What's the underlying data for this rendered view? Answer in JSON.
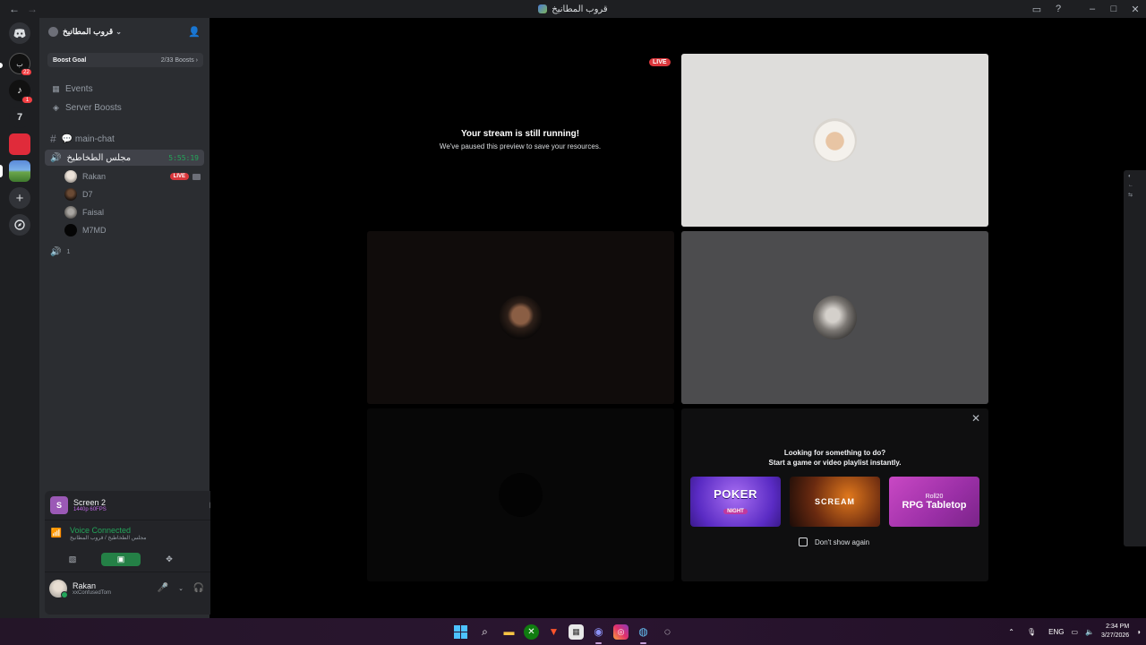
{
  "window": {
    "title": "قروب المطانيخ",
    "back": "←",
    "forward": "→"
  },
  "rail": {
    "badges": [
      "22",
      "1"
    ],
    "server_7_label": "7"
  },
  "server": {
    "name": "قروب المطانيخ",
    "boost_goal_label": "Boost Goal",
    "boost_count": "2/33 Boosts ›",
    "menu": [
      {
        "label": "Events",
        "icon": "calendar-icon"
      },
      {
        "label": "Server Boosts",
        "icon": "boost-icon"
      }
    ],
    "channels": {
      "text_channel": "💬 main-chat",
      "voice_channel": "مجلس الطخاطيخ",
      "voice_timer": "5:55:19",
      "voice_users": [
        {
          "name": "Rakan",
          "live": "LIVE"
        },
        {
          "name": "D7"
        },
        {
          "name": "Faisal"
        },
        {
          "name": "M7MD"
        }
      ],
      "second_voice_label": "1"
    }
  },
  "panel": {
    "stream_name": "Screen 2",
    "stream_quality": "1440p 60FPS",
    "stream_icon_letter": "S",
    "voice_status": "Voice Connected",
    "voice_location": "مجلس الطخاطيخ / قروب المطانيخ",
    "user_name": "Rakan",
    "user_status": "xxConfusedTom"
  },
  "stage": {
    "live_tag": "LIVE",
    "paused_title": "Your stream is still running!",
    "paused_subtitle": "We've paused this preview to save your resources.",
    "activity_title": "Looking for something to do?",
    "activity_subtitle": "Start a game or video playlist instantly.",
    "activity_cards": [
      {
        "label": "POKER",
        "sub": "NIGHT",
        "color": "#6b3fd1"
      },
      {
        "label": "SCREAM",
        "sub": "",
        "color": "#5a2412"
      },
      {
        "label": "RPG Tabletop",
        "sub": "Roll20",
        "color": "#b23bb8"
      }
    ],
    "dont_show": "Don't show again",
    "close": "✕"
  },
  "taskbar": {
    "lang": "ENG",
    "time": "2:34 PM",
    "date": "3/27/2026"
  },
  "colors": {
    "accent_green": "#23a55a",
    "live_red": "#da373c",
    "discord_bg": "#2b2d31"
  }
}
